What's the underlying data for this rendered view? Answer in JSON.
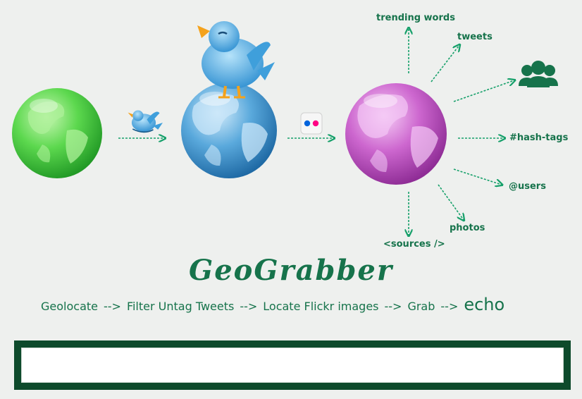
{
  "labels": {
    "trending": "trending words",
    "tweets": "tweets",
    "hashtags": "#hash-tags",
    "users": "@users",
    "photos": "photos",
    "sources": "<sources />"
  },
  "brand": "GeoGrabber",
  "pipeline": {
    "steps": [
      "Geolocate",
      "Filter Untag Tweets",
      "Locate Flickr images",
      "Grab"
    ],
    "arrow": "-->",
    "echo": "echo"
  },
  "colors": {
    "accent": "#16734b",
    "frame": "#0d4a2b",
    "green_globe": "#4cd04a",
    "blue_globe": "#4a9ed6",
    "pink_globe": "#c45ac8",
    "bird": "#4ba8e0",
    "flickr_blue": "#0063dc",
    "flickr_pink": "#ff0084"
  },
  "icons": [
    "green-globe-icon",
    "twitter-bird-icon",
    "blue-globe-icon",
    "flickr-icon",
    "pink-globe-icon",
    "users-group-icon"
  ]
}
